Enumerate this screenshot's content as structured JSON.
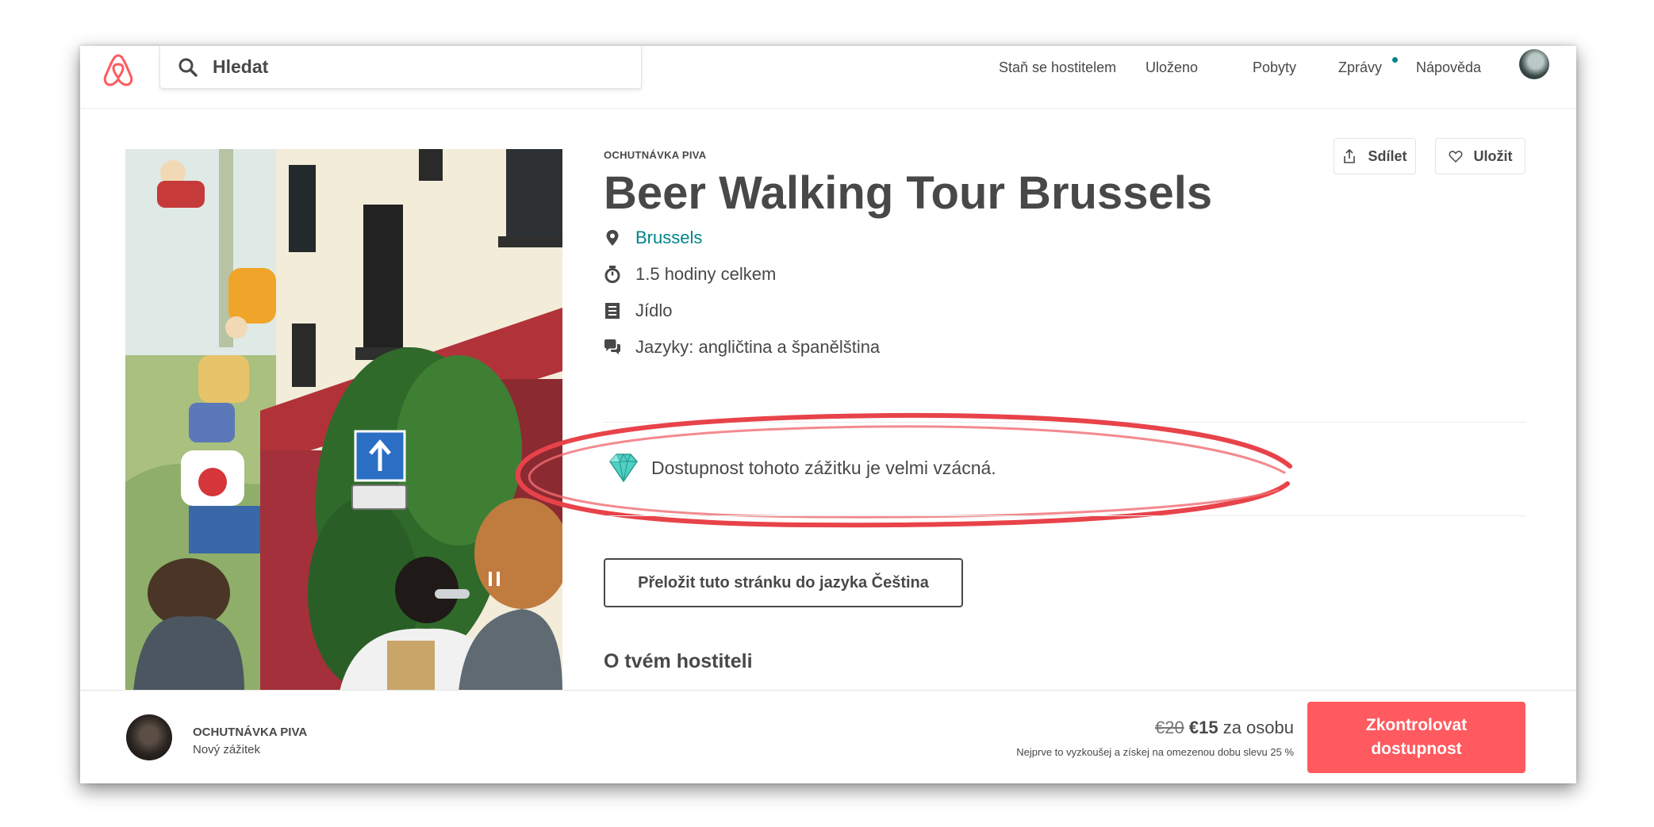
{
  "header": {
    "search_placeholder": "Hledat",
    "nav": [
      "Staň se hostitelem",
      "Uloženo",
      "Pobyty",
      "Zprávy",
      "Nápověda"
    ]
  },
  "experience": {
    "category": "OCHUTNÁVKA PIVA",
    "title": "Beer Walking Tour Brussels",
    "share_label": "Sdílet",
    "save_label": "Uložit",
    "location": "Brussels",
    "duration": "1.5 hodiny celkem",
    "food": "Jídlo",
    "languages": "Jazyky: angličtina a španělština",
    "rarity_note": "Dostupnost tohoto zážitku je velmi vzácná.",
    "translate_label": "Přeložit tuto stránku do jazyka Čeština",
    "host_heading": "O tvém hostiteli"
  },
  "footer": {
    "category": "OCHUTNÁVKA PIVA",
    "subtitle": "Nový zážitek",
    "price_old": "€20",
    "price_new": "€15",
    "price_unit": "za osobu",
    "discount_note": "Nejprve to vyzkoušej a získej na omezenou dobu slevu 25 %",
    "cta_label": "Zkontrolovat\ndostupnost"
  },
  "colors": {
    "accent": "#ff5a5f",
    "link": "#008489",
    "text": "#484848",
    "highlight": "#e8434a"
  },
  "icons": [
    "airbnb-logo",
    "search-icon",
    "share-icon",
    "heart-icon",
    "location-pin-icon",
    "timer-icon",
    "food-menu-icon",
    "speech-bubbles-icon",
    "diamond-icon",
    "pause-icon"
  ]
}
